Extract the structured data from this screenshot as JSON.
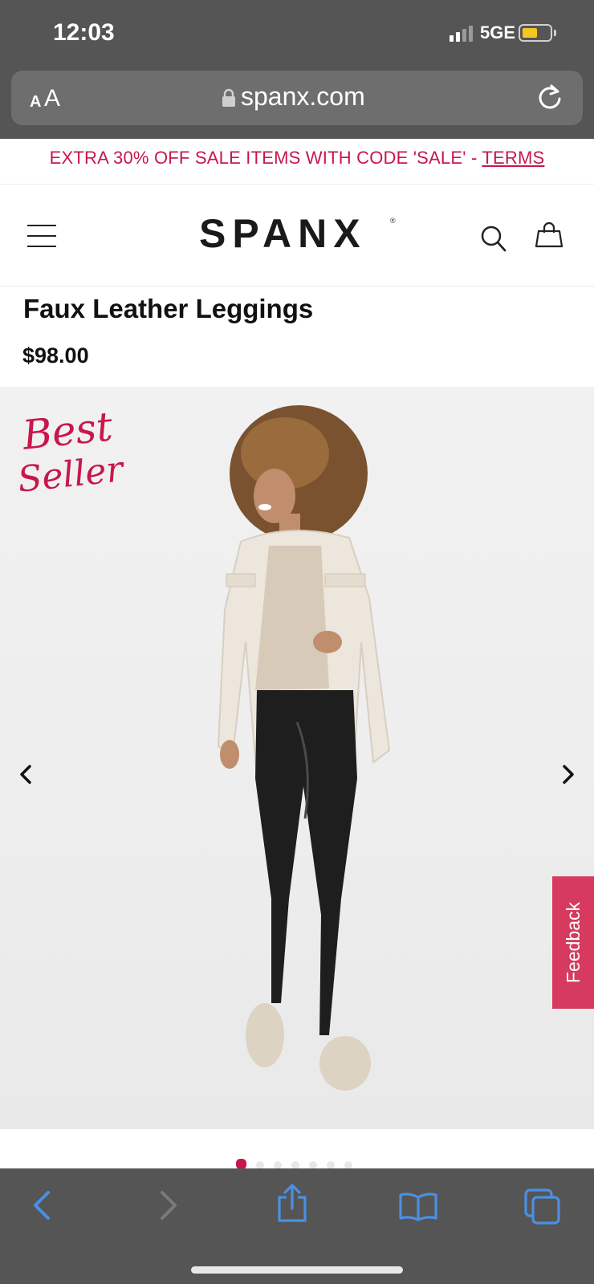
{
  "status_bar": {
    "time": "12:03",
    "network": "5GE"
  },
  "browser": {
    "aa_label_small": "A",
    "aa_label_big": "A",
    "url": "spanx.com"
  },
  "promo": {
    "text": "EXTRA 30% OFF SALE ITEMS WITH CODE 'SALE' - ",
    "terms": "TERMS"
  },
  "header": {
    "logo": "SPANX",
    "logo_mark": "®"
  },
  "product": {
    "title": "Faux Leather Leggings",
    "price": "$98.00"
  },
  "hero": {
    "badge_line1": "Best",
    "badge_line2": "Seller",
    "image_count": 7,
    "active_index": 0,
    "image_desc": "model wearing cream shirt jacket and black faux leather leggings"
  },
  "feedback": {
    "label": "Feedback"
  },
  "colors": {
    "accent": "#c8174a",
    "chrome": "#555555",
    "ios_blue": "#4a90e2"
  },
  "icons": [
    "lock-icon",
    "reload-icon",
    "menu-icon",
    "search-icon",
    "bag-icon",
    "chevron-left-icon",
    "chevron-right-icon",
    "back-icon",
    "forward-icon",
    "share-icon",
    "bookmarks-icon",
    "tabs-icon"
  ]
}
